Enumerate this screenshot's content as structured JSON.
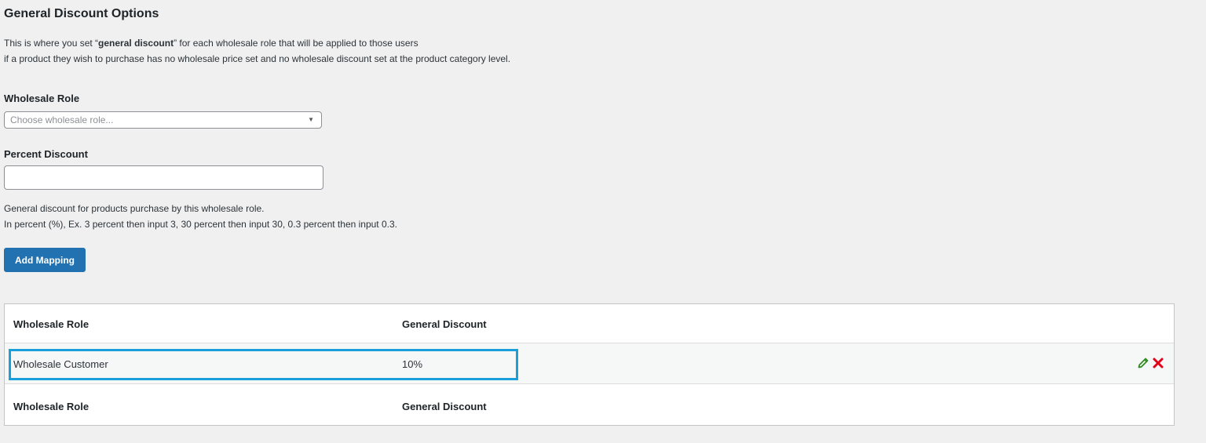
{
  "section": {
    "title": "General Discount Options",
    "intro_prefix": "This is where you set “",
    "intro_bold": "general discount",
    "intro_suffix": "” for each wholesale role that will be applied to those users",
    "intro_line2": "if a product they wish to purchase has no wholesale price set and no wholesale discount set at the product category level."
  },
  "form": {
    "role_label": "Wholesale Role",
    "role_placeholder": "Choose wholesale role...",
    "percent_label": "Percent Discount",
    "percent_value": "",
    "help_line1": "General discount for products purchase by this wholesale role.",
    "help_line2": "In percent (%), Ex. 3 percent then input 3, 30 percent then input 30, 0.3 percent then input 0.3.",
    "add_button": "Add Mapping"
  },
  "table": {
    "headers": [
      "Wholesale Role",
      "General Discount"
    ],
    "rows": [
      {
        "role": "Wholesale Customer",
        "discount": "10%"
      }
    ],
    "footers": [
      "Wholesale Role",
      "General Discount"
    ]
  },
  "colors": {
    "primary": "#2271b1",
    "highlight": "#1a9fdb",
    "edit": "#2e8b1f",
    "delete": "#e0001a"
  },
  "icons": {
    "edit": "pencil-icon",
    "delete": "close-icon",
    "dropdown": "chevron-down-icon"
  }
}
